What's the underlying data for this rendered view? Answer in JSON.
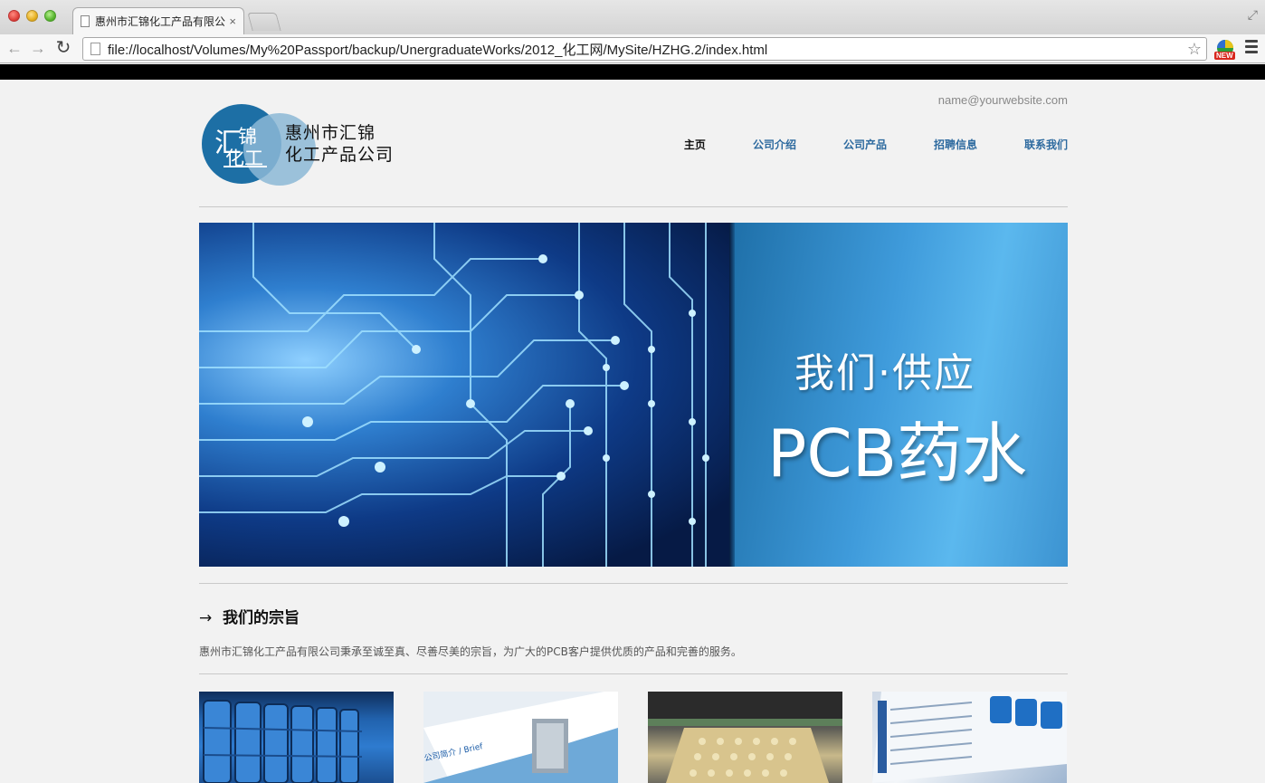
{
  "browser": {
    "tab_title": "惠州市汇锦化工产品有限公司",
    "tab_close": "×",
    "url": "file://localhost/Volumes/My%20Passport/backup/UnergraduateWorks/2012_化工网/MySite/HZHG.2/index.html",
    "back_icon": "←",
    "forward_icon": "→",
    "reload_icon": "↻",
    "star_icon": "☆",
    "resize_icon": "⤢",
    "extension_badge": "NEW"
  },
  "header": {
    "email": "name@yourwebsite.com",
    "logo": {
      "mark_top": "汇",
      "mark_right": "锦",
      "mark_bottom": "化工",
      "line1": "惠州市汇锦",
      "line2": "化工产品公司"
    },
    "nav": [
      {
        "label": "主页",
        "active": true
      },
      {
        "label": "公司介绍",
        "active": false
      },
      {
        "label": "公司产品",
        "active": false
      },
      {
        "label": "招聘信息",
        "active": false
      },
      {
        "label": "联系我们",
        "active": false
      }
    ]
  },
  "banner": {
    "line1": "我们·供应",
    "line2": "PCB药水"
  },
  "section": {
    "arrow": "→",
    "title": "我们的宗旨",
    "text": "惠州市汇锦化工产品有限公司秉承至诚至真、尽善尽美的宗旨，为广大的PCB客户提供优质的产品和完善的服务。"
  },
  "thumbnails": {
    "brochure_text": "公司简介 / Brief"
  },
  "colors": {
    "nav_link": "#2d6a9f",
    "logo_blue": "#1d6fa5",
    "banner_blue": "#3f9bdb"
  }
}
